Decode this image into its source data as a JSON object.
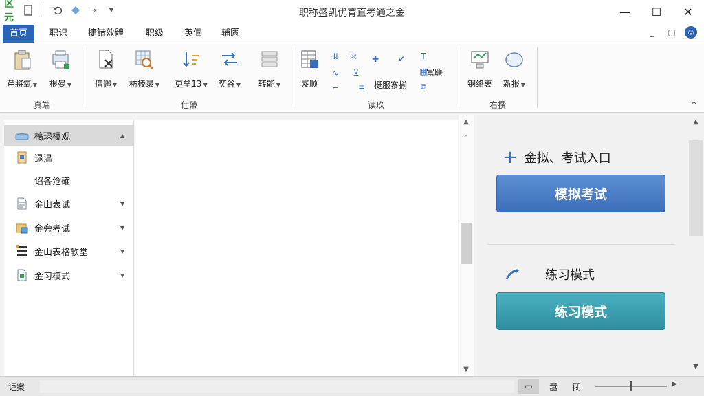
{
  "window": {
    "title": "职称盛凯优育直考通之金"
  },
  "qat": {
    "logo": "区元",
    "icons": [
      "doc-icon",
      "undo-icon",
      "diamond-icon",
      "redo-icon",
      "customize-icon"
    ]
  },
  "winctl": {
    "minimize": "—",
    "maximize": "☐",
    "close": "✕"
  },
  "tabs": [
    {
      "label": "首页",
      "active": true
    },
    {
      "label": "职识",
      "active": false
    },
    {
      "label": "捷错效體",
      "active": false
    },
    {
      "label": "职级",
      "active": false
    },
    {
      "label": "英個",
      "active": false
    },
    {
      "label": "辅匮",
      "active": false
    }
  ],
  "ribbon": {
    "groups": [
      {
        "label": "真端"
      },
      {
        "label": "仕帶"
      },
      {
        "label": "读玖"
      },
      {
        "label": "右撰"
      }
    ],
    "buttons": {
      "b1": "芹將氧",
      "b2": "根曼",
      "b3": "借儷",
      "b4": "枋棱录",
      "b5": "更垒13",
      "b6": "奕谷",
      "b7": "转能",
      "b8": "岌顺",
      "b9": "梃服寨揃",
      "b10": "冨联",
      "b11": "钢络衷",
      "b12": "新报"
    },
    "collapse_icon": "^"
  },
  "nav": {
    "items": [
      {
        "label": "槁琭模观",
        "icon": "home-icon",
        "expand": "▲",
        "active": true
      },
      {
        "label": "逯温",
        "icon": "doc-icon",
        "expand": "",
        "active": false
      },
      {
        "label": "诏各沧確",
        "icon": "",
        "expand": "",
        "active": false
      },
      {
        "label": "金山表试",
        "icon": "page-icon",
        "expand": "▼",
        "active": false
      },
      {
        "label": "金旁考试",
        "icon": "folder-icon",
        "expand": "▼",
        "active": false
      },
      {
        "label": "金山表格软堂",
        "icon": "list-icon",
        "expand": "▼",
        "active": false
      },
      {
        "label": "金习模式",
        "icon": "test-icon",
        "expand": "▼",
        "active": false
      }
    ]
  },
  "panel": {
    "section1_title": "金拟、考试入口",
    "section1_button": "模拟考试",
    "section2_title": "练习模式",
    "section2_button": "练习模式"
  },
  "status": {
    "text": "讵案",
    "views": [
      "▭",
      "嚣",
      "闭"
    ]
  },
  "colors": {
    "accent": "#2b63b6",
    "blue_button": "#4a7cc4",
    "teal_button": "#3a9eae"
  }
}
